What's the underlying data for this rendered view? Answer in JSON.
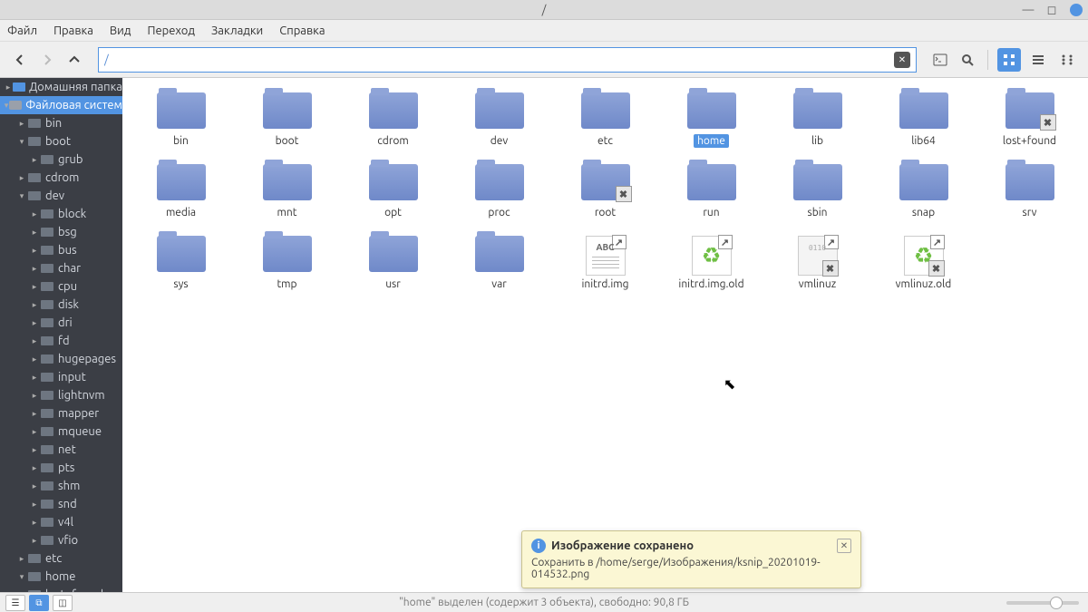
{
  "window": {
    "title": "/"
  },
  "menu": [
    "Файл",
    "Правка",
    "Вид",
    "Переход",
    "Закладки",
    "Справка"
  ],
  "path": "/",
  "sidebar": [
    {
      "lvl": 0,
      "arrow": "▸",
      "icon": "home",
      "label": "Домашняя папка"
    },
    {
      "lvl": 0,
      "arrow": "▾",
      "icon": "drive",
      "label": "Файловая систем",
      "active": true
    },
    {
      "lvl": 1,
      "arrow": "▸",
      "icon": "folder",
      "label": "bin"
    },
    {
      "lvl": 1,
      "arrow": "▾",
      "icon": "folder",
      "label": "boot"
    },
    {
      "lvl": 2,
      "arrow": "▸",
      "icon": "folder",
      "label": "grub"
    },
    {
      "lvl": 1,
      "arrow": "▸",
      "icon": "folder",
      "label": "cdrom"
    },
    {
      "lvl": 1,
      "arrow": "▾",
      "icon": "folder",
      "label": "dev"
    },
    {
      "lvl": 2,
      "arrow": "▸",
      "icon": "folder",
      "label": "block"
    },
    {
      "lvl": 2,
      "arrow": "▸",
      "icon": "folder",
      "label": "bsg"
    },
    {
      "lvl": 2,
      "arrow": "▸",
      "icon": "folder",
      "label": "bus"
    },
    {
      "lvl": 2,
      "arrow": "▸",
      "icon": "folder",
      "label": "char"
    },
    {
      "lvl": 2,
      "arrow": "▸",
      "icon": "folder",
      "label": "cpu"
    },
    {
      "lvl": 2,
      "arrow": "▸",
      "icon": "folder",
      "label": "disk"
    },
    {
      "lvl": 2,
      "arrow": "▸",
      "icon": "folder",
      "label": "dri"
    },
    {
      "lvl": 2,
      "arrow": "▸",
      "icon": "folder",
      "label": "fd"
    },
    {
      "lvl": 2,
      "arrow": "▸",
      "icon": "folder",
      "label": "hugepages"
    },
    {
      "lvl": 2,
      "arrow": "▸",
      "icon": "folder",
      "label": "input"
    },
    {
      "lvl": 2,
      "arrow": "▸",
      "icon": "folder",
      "label": "lightnvm"
    },
    {
      "lvl": 2,
      "arrow": "▸",
      "icon": "folder",
      "label": "mapper"
    },
    {
      "lvl": 2,
      "arrow": "▸",
      "icon": "folder",
      "label": "mqueue"
    },
    {
      "lvl": 2,
      "arrow": "▸",
      "icon": "folder",
      "label": "net"
    },
    {
      "lvl": 2,
      "arrow": "▸",
      "icon": "folder",
      "label": "pts"
    },
    {
      "lvl": 2,
      "arrow": "▸",
      "icon": "folder",
      "label": "shm"
    },
    {
      "lvl": 2,
      "arrow": "▸",
      "icon": "folder",
      "label": "snd"
    },
    {
      "lvl": 2,
      "arrow": "▸",
      "icon": "folder",
      "label": "v4l"
    },
    {
      "lvl": 2,
      "arrow": "▸",
      "icon": "folder",
      "label": "vfio"
    },
    {
      "lvl": 1,
      "arrow": "▸",
      "icon": "folder",
      "label": "etc"
    },
    {
      "lvl": 1,
      "arrow": "▾",
      "icon": "folder",
      "label": "home"
    },
    {
      "lvl": 1,
      "arrow": "▸",
      "icon": "folder",
      "label": "lost+found"
    }
  ],
  "items": [
    {
      "label": "bin",
      "type": "folder"
    },
    {
      "label": "boot",
      "type": "folder"
    },
    {
      "label": "cdrom",
      "type": "folder"
    },
    {
      "label": "dev",
      "type": "folder"
    },
    {
      "label": "etc",
      "type": "folder"
    },
    {
      "label": "home",
      "type": "folder",
      "selected": true
    },
    {
      "label": "lib",
      "type": "folder"
    },
    {
      "label": "lib64",
      "type": "folder"
    },
    {
      "label": "lost+found",
      "type": "folder",
      "locked": true
    },
    {
      "label": "media",
      "type": "folder"
    },
    {
      "label": "mnt",
      "type": "folder"
    },
    {
      "label": "opt",
      "type": "folder"
    },
    {
      "label": "proc",
      "type": "folder"
    },
    {
      "label": "root",
      "type": "folder",
      "locked": true
    },
    {
      "label": "run",
      "type": "folder"
    },
    {
      "label": "sbin",
      "type": "folder"
    },
    {
      "label": "snap",
      "type": "folder"
    },
    {
      "label": "srv",
      "type": "folder"
    },
    {
      "label": "sys",
      "type": "folder"
    },
    {
      "label": "tmp",
      "type": "folder"
    },
    {
      "label": "usr",
      "type": "folder"
    },
    {
      "label": "var",
      "type": "folder"
    },
    {
      "label": "initrd.img",
      "type": "txt",
      "link": true
    },
    {
      "label": "initrd.img.old",
      "type": "recycle",
      "link": true
    },
    {
      "label": "vmlinuz",
      "type": "bin",
      "link": true,
      "locked": true
    },
    {
      "label": "vmlinuz.old",
      "type": "recycle",
      "link": true,
      "locked": true
    }
  ],
  "status": "\"home\" выделен (содержит 3 объекта), свободно: 90,8 ГБ",
  "notif": {
    "title": "Изображение сохранено",
    "body": "Сохранить в /home/serge/Изображения/ksnip_20201019-014532.png"
  }
}
